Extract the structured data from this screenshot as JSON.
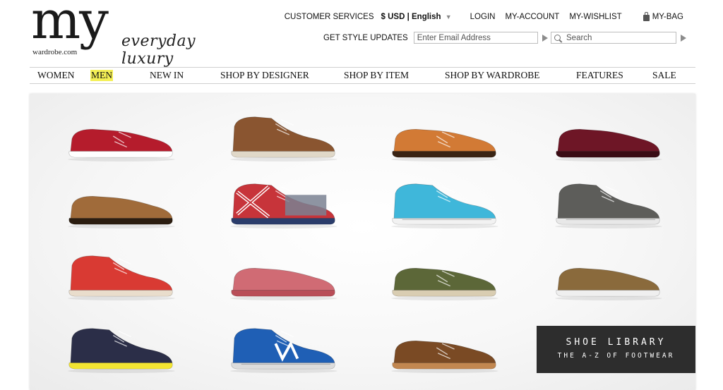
{
  "brand": {
    "logo_text": "my",
    "site": "wardrobe.com",
    "tagline": "everyday luxury"
  },
  "topbar": {
    "customer_services": "CUSTOMER SERVICES",
    "currency": "$ USD",
    "separator": "|",
    "language": "English",
    "login": "LOGIN",
    "account": "MY-ACCOUNT",
    "wishlist": "MY-WISHLIST",
    "bag": "MY-BAG",
    "bag_icon": "shopping-bag-icon"
  },
  "updates": {
    "label": "GET STYLE UPDATES",
    "email_placeholder": "Enter Email Address",
    "search_placeholder": "Search"
  },
  "nav": {
    "items": [
      "WOMEN",
      "MEN",
      "NEW IN",
      "SHOP BY DESIGNER",
      "SHOP BY ITEM",
      "SHOP BY WARDROBE",
      "FEATURES",
      "SALE"
    ],
    "active": "MEN",
    "highlight_color": "#f4ef55"
  },
  "products": [
    {
      "kind": "boat-shoe",
      "colors": [
        "#b51c2c",
        "#ffffff"
      ]
    },
    {
      "kind": "chukka",
      "colors": [
        "#8a5530",
        "#e0d8c8"
      ]
    },
    {
      "kind": "brogue",
      "colors": [
        "#d27a35",
        "#3a2414"
      ]
    },
    {
      "kind": "loafer",
      "colors": [
        "#6e1626",
        "#3a0c14"
      ]
    },
    {
      "kind": "slipper",
      "colors": [
        "#a06b3a",
        "#2b1d10"
      ]
    },
    {
      "kind": "union-jack-chukka",
      "colors": [
        "#c7343a",
        "#2b3d6b"
      ]
    },
    {
      "kind": "sneaker",
      "colors": [
        "#3fb7da",
        "#f2f2f2"
      ]
    },
    {
      "kind": "high-top",
      "colors": [
        "#5d5d5a",
        "#e8e8e8"
      ]
    },
    {
      "kind": "chukka",
      "colors": [
        "#d93a33",
        "#e9ddcc"
      ]
    },
    {
      "kind": "driving-moc",
      "colors": [
        "#d06b74",
        "#b94e58"
      ]
    },
    {
      "kind": "brogue",
      "colors": [
        "#5c6738",
        "#d9cdb2"
      ]
    },
    {
      "kind": "slip-on",
      "colors": [
        "#8a6a3c",
        "#efefef"
      ]
    },
    {
      "kind": "chukka",
      "colors": [
        "#2b2e48",
        "#f3e532"
      ]
    },
    {
      "kind": "runner",
      "colors": [
        "#1f5fb5",
        "#dcdcdc"
      ]
    },
    {
      "kind": "brogue",
      "colors": [
        "#7a4a24",
        "#c28750"
      ]
    }
  ],
  "banner": {
    "title": "SHOE LIBRARY",
    "subtitle": "THE A-Z OF FOOTWEAR"
  }
}
